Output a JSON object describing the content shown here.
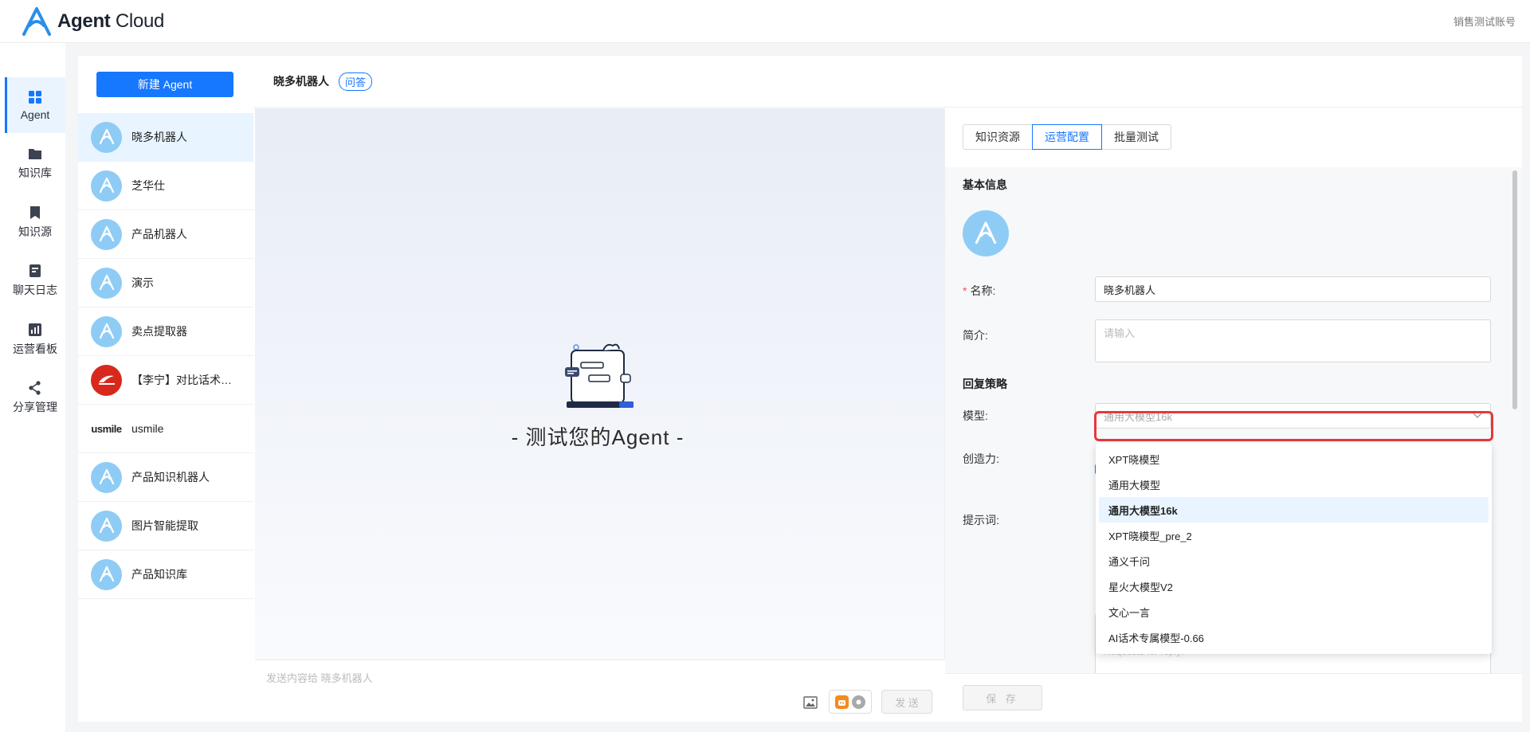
{
  "app": {
    "logo_text_bold": "Agent",
    "logo_text_regular": "Cloud",
    "account": "销售测试账号"
  },
  "nav": [
    {
      "id": "agent",
      "label": "Agent",
      "icon": "grid-icon",
      "active": true
    },
    {
      "id": "kb",
      "label": "知识库",
      "icon": "folder-icon"
    },
    {
      "id": "source",
      "label": "知识源",
      "icon": "bookmark-icon"
    },
    {
      "id": "logs",
      "label": "聊天日志",
      "icon": "log-icon"
    },
    {
      "id": "dashboard",
      "label": "运营看板",
      "icon": "chart-icon"
    },
    {
      "id": "share",
      "label": "分享管理",
      "icon": "share-icon"
    }
  ],
  "list": {
    "new_button": "新建 Agent",
    "agents": [
      {
        "name": "晓多机器人",
        "avatar": "agent-logo",
        "active": true
      },
      {
        "name": "芝华仕",
        "avatar": "agent-logo"
      },
      {
        "name": "产品机器人",
        "avatar": "agent-logo"
      },
      {
        "name": "演示",
        "avatar": "agent-logo"
      },
      {
        "name": "卖点提取器",
        "avatar": "agent-logo"
      },
      {
        "name": "【李宁】对比话术…",
        "avatar": "lining-logo"
      },
      {
        "name": "usmile",
        "avatar": "usmile-logo",
        "logo_text": "usmile"
      },
      {
        "name": "产品知识机器人",
        "avatar": "agent-logo"
      },
      {
        "name": "图片智能提取",
        "avatar": "agent-logo"
      },
      {
        "name": "产品知识库",
        "avatar": "agent-logo"
      }
    ]
  },
  "main": {
    "title": "晓多机器人",
    "tag": "问答"
  },
  "chat": {
    "empty_title": "- 测试您的Agent -",
    "input_placeholder": "发送内容给 晓多机器人",
    "send_label": "发 送"
  },
  "config": {
    "tabs": [
      {
        "label": "知识资源"
      },
      {
        "label": "运营配置",
        "active": true
      },
      {
        "label": "批量测试"
      }
    ],
    "basic_info": "基本信息",
    "name_label": "名称:",
    "name_value": "晓多机器人",
    "intro_label": "简介:",
    "intro_placeholder": "请输入",
    "reply_strategy": "回复策略",
    "model_label": "模型:",
    "model_value": "通用大模型16k",
    "creativity_label": "创造力:",
    "prompt_label": "提示词:",
    "prompt_placeholder": "Requests for reply:",
    "save_label": "保 存",
    "model_options": [
      "XPT晓模型",
      "通用大模型",
      "通用大模型16k",
      "XPT晓模型_pre_2",
      "通义千问",
      "星火大模型V2",
      "文心一言",
      "AI话术专属模型-0.66"
    ]
  },
  "colors": {
    "accent": "#1677ff",
    "highlight": "#e8373c",
    "avatar": "#8fccf5"
  }
}
